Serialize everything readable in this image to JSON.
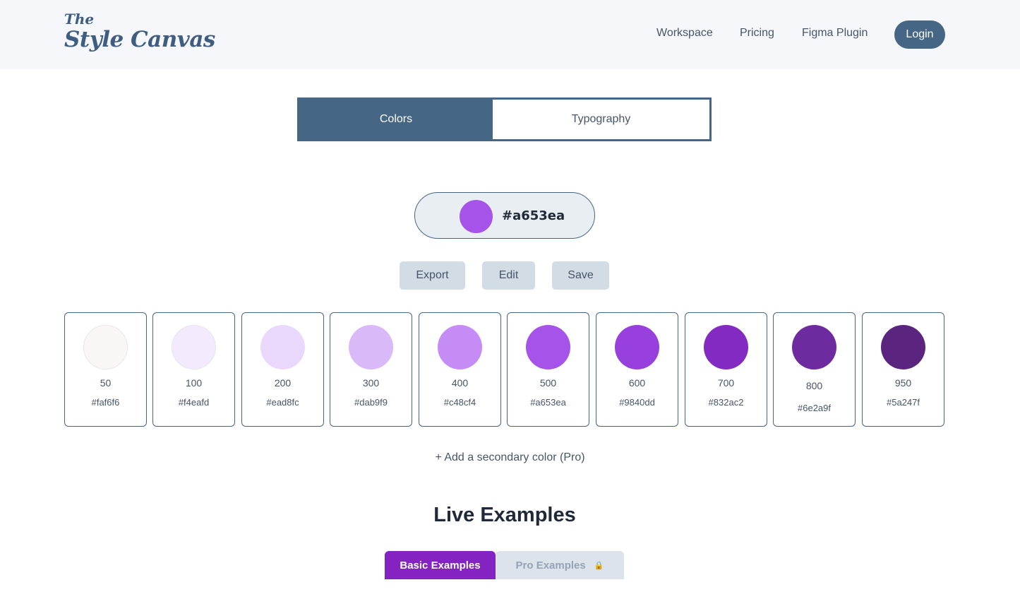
{
  "header": {
    "logo_top": "The",
    "logo_main": "Style Canvas",
    "nav": {
      "workspace": "Workspace",
      "pricing": "Pricing",
      "figma_plugin": "Figma Plugin",
      "login": "Login"
    }
  },
  "mode_tabs": {
    "colors": "Colors",
    "typography": "Typography",
    "active": "Colors"
  },
  "color_picker": {
    "hex": "#a653ea",
    "swatch_color": "#a653ea"
  },
  "actions": {
    "export": "Export",
    "edit": "Edit",
    "save": "Save"
  },
  "palette": [
    {
      "weight": "50",
      "hex": "#faf6f6",
      "color": "#faf6f6"
    },
    {
      "weight": "100",
      "hex": "#f4eafd",
      "color": "#f4eafd"
    },
    {
      "weight": "200",
      "hex": "#ead8fc",
      "color": "#ead8fc"
    },
    {
      "weight": "300",
      "hex": "#dab9f9",
      "color": "#dab9f9"
    },
    {
      "weight": "400",
      "hex": "#c48cf4",
      "color": "#c48cf4"
    },
    {
      "weight": "500",
      "hex": "#a653ea",
      "color": "#a653ea"
    },
    {
      "weight": "600",
      "hex": "#9840dd",
      "color": "#9840dd"
    },
    {
      "weight": "700",
      "hex": "#832ac2",
      "color": "#832ac2"
    },
    {
      "weight": "800",
      "hex": "#6e2a9f",
      "color": "#6e2a9f"
    },
    {
      "weight": "950",
      "hex": "#5a247f",
      "color": "#5a247f"
    }
  ],
  "add_secondary": "+ Add a secondary color (Pro)",
  "live_examples": {
    "title": "Live Examples",
    "basic_tab": "Basic Examples",
    "pro_tab": "Pro Examples",
    "pro_tab_icon": "lock-icon"
  },
  "colors": {
    "header_bg": "#f5f7fa",
    "primary_slate": "#456684",
    "accent_purple": "#8422c2"
  }
}
